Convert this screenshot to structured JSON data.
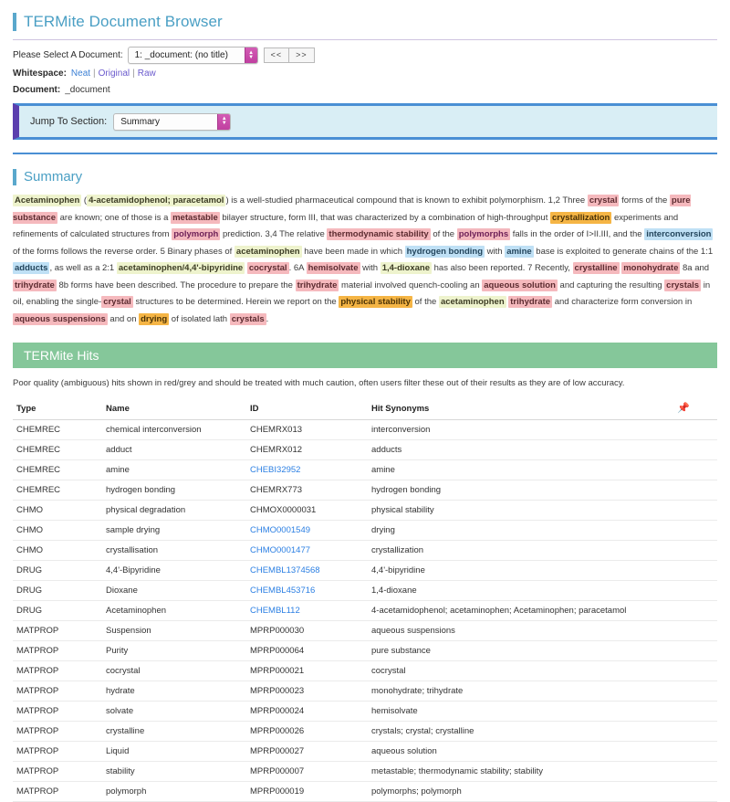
{
  "app": {
    "title": "TERMite Document Browser"
  },
  "controls": {
    "document_select_label": "Please Select A Document:",
    "document_select_value": "1: _document: (no title)",
    "prev_button": "<<",
    "next_button": ">>",
    "whitespace_label": "Whitespace:",
    "whitespace_options": [
      "Neat",
      "Original",
      "Raw"
    ],
    "whitespace_separator": "|",
    "document_label": "Document:",
    "document_name": "_document",
    "jump_label": "Jump To Section:",
    "jump_value": "Summary"
  },
  "summary": {
    "heading": "Summary",
    "runs": [
      {
        "t": "Acetaminophen",
        "c": "hl-drug"
      },
      {
        "t": " (",
        "c": ""
      },
      {
        "t": "4-acetamidophenol; paracetamol",
        "c": "hl-drug"
      },
      {
        "t": ") is a well-studied pharmaceutical compound that is known to exhibit polymorphism. 1,2 Three ",
        "c": ""
      },
      {
        "t": "crystal",
        "c": "hl-matprop"
      },
      {
        "t": " forms of the ",
        "c": ""
      },
      {
        "t": "pure substance",
        "c": "hl-matprop"
      },
      {
        "t": " are known; one of those is a ",
        "c": ""
      },
      {
        "t": "metastable",
        "c": "hl-matprop"
      },
      {
        "t": " bilayer structure, form III, that was characterized by a combination of high-throughput ",
        "c": ""
      },
      {
        "t": "crystallization",
        "c": "hl-chmo"
      },
      {
        "t": " experiments and refinements of calculated structures from ",
        "c": ""
      },
      {
        "t": "polymorph",
        "c": "hl-polymorph"
      },
      {
        "t": " prediction. 3,4 The relative ",
        "c": ""
      },
      {
        "t": "thermodynamic stability",
        "c": "hl-matprop"
      },
      {
        "t": " of the ",
        "c": ""
      },
      {
        "t": "polymorphs",
        "c": "hl-polymorph"
      },
      {
        "t": " falls in the order of I>II.III, and the ",
        "c": ""
      },
      {
        "t": "interconversion",
        "c": "hl-chemrec"
      },
      {
        "t": " of the forms follows the reverse order. 5 Binary phases of ",
        "c": ""
      },
      {
        "t": "acetaminophen",
        "c": "hl-drug"
      },
      {
        "t": " have been made in which ",
        "c": ""
      },
      {
        "t": "hydrogen bonding",
        "c": "hl-chemrec"
      },
      {
        "t": " with ",
        "c": ""
      },
      {
        "t": "amine",
        "c": "hl-chemrec"
      },
      {
        "t": " base is exploited to generate chains of the 1:1 ",
        "c": ""
      },
      {
        "t": "adducts",
        "c": "hl-chemrec"
      },
      {
        "t": ", as well as a 2:1 ",
        "c": ""
      },
      {
        "t": "acetaminophen/4,4'-bipyridine",
        "c": "hl-drug"
      },
      {
        "t": " ",
        "c": ""
      },
      {
        "t": "cocrystal",
        "c": "hl-matprop"
      },
      {
        "t": ". 6A ",
        "c": ""
      },
      {
        "t": "hemisolvate",
        "c": "hl-matprop"
      },
      {
        "t": " with ",
        "c": ""
      },
      {
        "t": "1,4-dioxane",
        "c": "hl-drug"
      },
      {
        "t": " has also been reported. 7 Recently, ",
        "c": ""
      },
      {
        "t": "crystalline",
        "c": "hl-matprop"
      },
      {
        "t": " ",
        "c": ""
      },
      {
        "t": "monohydrate",
        "c": "hl-matprop"
      },
      {
        "t": " 8a and ",
        "c": ""
      },
      {
        "t": "trihydrate",
        "c": "hl-matprop"
      },
      {
        "t": " 8b forms have been described. The procedure to prepare the ",
        "c": ""
      },
      {
        "t": "trihydrate",
        "c": "hl-matprop"
      },
      {
        "t": " material involved quench-cooling an ",
        "c": ""
      },
      {
        "t": "aqueous solution",
        "c": "hl-matprop"
      },
      {
        "t": " and capturing the resulting ",
        "c": ""
      },
      {
        "t": "crystals",
        "c": "hl-matprop"
      },
      {
        "t": " in oil, enabling the single-",
        "c": ""
      },
      {
        "t": "crystal",
        "c": "hl-matprop"
      },
      {
        "t": " structures to be determined. Herein we report on the ",
        "c": ""
      },
      {
        "t": "physical stability",
        "c": "hl-chmo"
      },
      {
        "t": " of the ",
        "c": ""
      },
      {
        "t": "acetaminophen",
        "c": "hl-drug"
      },
      {
        "t": " ",
        "c": ""
      },
      {
        "t": "trihydrate",
        "c": "hl-matprop"
      },
      {
        "t": " and characterize form conversion in ",
        "c": ""
      },
      {
        "t": "aqueous suspensions",
        "c": "hl-matprop"
      },
      {
        "t": " and on ",
        "c": ""
      },
      {
        "t": "drying",
        "c": "hl-chmo"
      },
      {
        "t": " of isolated lath ",
        "c": ""
      },
      {
        "t": "crystals",
        "c": "hl-matprop"
      },
      {
        "t": ".",
        "c": ""
      }
    ]
  },
  "hits": {
    "banner": "TERMite Hits",
    "note": "Poor quality (ambiguous) hits shown in red/grey and should be treated with much caution, often users filter these out of their results as they are of low accuracy.",
    "columns": [
      "Type",
      "Name",
      "ID",
      "Hit Synonyms"
    ],
    "pin_icon": "pin-icon",
    "rows": [
      {
        "type": "CHEMREC",
        "name": "chemical interconversion",
        "id": "CHEMRX013",
        "id_link": false,
        "synonyms": "interconversion"
      },
      {
        "type": "CHEMREC",
        "name": "adduct",
        "id": "CHEMRX012",
        "id_link": false,
        "synonyms": "adducts"
      },
      {
        "type": "CHEMREC",
        "name": "amine",
        "id": "CHEBI32952",
        "id_link": true,
        "synonyms": "amine"
      },
      {
        "type": "CHEMREC",
        "name": "hydrogen bonding",
        "id": "CHEMRX773",
        "id_link": false,
        "synonyms": "hydrogen bonding"
      },
      {
        "type": "CHMO",
        "name": "physical degradation",
        "id": "CHMOX0000031",
        "id_link": false,
        "synonyms": "physical stability"
      },
      {
        "type": "CHMO",
        "name": "sample drying",
        "id": "CHMO0001549",
        "id_link": true,
        "synonyms": "drying"
      },
      {
        "type": "CHMO",
        "name": "crystallisation",
        "id": "CHMO0001477",
        "id_link": true,
        "synonyms": "crystallization"
      },
      {
        "type": "DRUG",
        "name": "4,4'-Bipyridine",
        "id": "CHEMBL1374568",
        "id_link": true,
        "synonyms": "4,4'-bipyridine"
      },
      {
        "type": "DRUG",
        "name": "Dioxane",
        "id": "CHEMBL453716",
        "id_link": true,
        "synonyms": "1,4-dioxane"
      },
      {
        "type": "DRUG",
        "name": "Acetaminophen",
        "id": "CHEMBL112",
        "id_link": true,
        "synonyms": "4-acetamidophenol; acetaminophen; Acetaminophen; paracetamol"
      },
      {
        "type": "MATPROP",
        "name": "Suspension",
        "id": "MPRP000030",
        "id_link": false,
        "synonyms": "aqueous suspensions"
      },
      {
        "type": "MATPROP",
        "name": "Purity",
        "id": "MPRP000064",
        "id_link": false,
        "synonyms": "pure substance"
      },
      {
        "type": "MATPROP",
        "name": "cocrystal",
        "id": "MPRP000021",
        "id_link": false,
        "synonyms": "cocrystal"
      },
      {
        "type": "MATPROP",
        "name": "hydrate",
        "id": "MPRP000023",
        "id_link": false,
        "synonyms": "monohydrate; trihydrate"
      },
      {
        "type": "MATPROP",
        "name": "solvate",
        "id": "MPRP000024",
        "id_link": false,
        "synonyms": "hemisolvate"
      },
      {
        "type": "MATPROP",
        "name": "crystalline",
        "id": "MPRP000026",
        "id_link": false,
        "synonyms": "crystals; crystal; crystalline"
      },
      {
        "type": "MATPROP",
        "name": "Liquid",
        "id": "MPRP000027",
        "id_link": false,
        "synonyms": "aqueous solution"
      },
      {
        "type": "MATPROP",
        "name": "stability",
        "id": "MPRP000007",
        "id_link": false,
        "synonyms": "metastable; thermodynamic stability; stability"
      },
      {
        "type": "MATPROP",
        "name": "polymorph",
        "id": "MPRP000019",
        "id_link": false,
        "synonyms": "polymorphs; polymorph"
      }
    ]
  },
  "colors": {
    "title_blue": "#4a9fc4",
    "accent_purple": "#5b3fae",
    "jump_bar_bg": "#d9eef5",
    "jump_bar_border": "#4a8fd4",
    "hits_green": "#85c79a",
    "select_arrow_magenta": "#c03fa0",
    "link_blue": "#2b7fe3",
    "highlight_drug": "#eef3cd",
    "highlight_matprop": "#f5b9bd",
    "highlight_chmo": "#f5b545",
    "highlight_chemrec": "#bfe0f5",
    "highlight_polymorph": "#f3b7bd"
  }
}
